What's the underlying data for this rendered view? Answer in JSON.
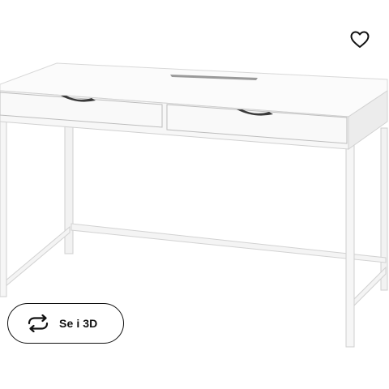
{
  "product_image": {
    "icon": "white-desk-with-two-drawers",
    "accent": "#ffffff"
  },
  "favourite": {
    "icon": "heart-outline-icon"
  },
  "view_3d": {
    "label": "Se i 3D",
    "icon": "rotate-arrows-icon"
  }
}
